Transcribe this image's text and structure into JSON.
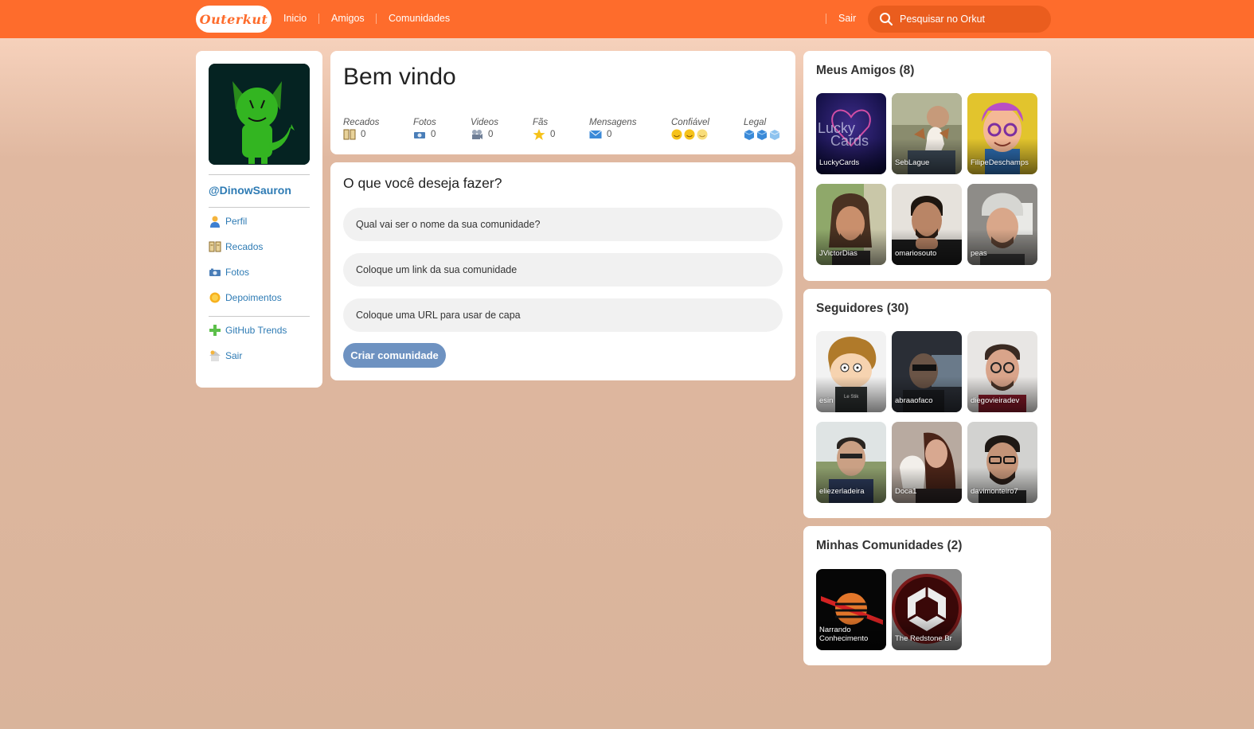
{
  "header": {
    "logo": "Outerkut",
    "nav": [
      "Inicio",
      "Amigos",
      "Comunidades"
    ],
    "logout": "Sair",
    "search_placeholder": "Pesquisar no Orkut"
  },
  "sidebar": {
    "username": "@DinowSauron",
    "menu": [
      "Perfil",
      "Recados",
      "Fotos",
      "Depoimentos"
    ],
    "menu2": [
      "GitHub Trends",
      "Sair"
    ]
  },
  "welcome": {
    "title": "Bem vindo",
    "stats": [
      {
        "label": "Recados",
        "value": "0"
      },
      {
        "label": "Fotos",
        "value": "0"
      },
      {
        "label": "Videos",
        "value": "0"
      },
      {
        "label": "Fãs",
        "value": "0"
      },
      {
        "label": "Mensagens",
        "value": "0"
      },
      {
        "label": "Confiável"
      },
      {
        "label": "Legal"
      }
    ]
  },
  "form": {
    "title": "O que você deseja fazer?",
    "fields": [
      "Qual vai ser o nome da sua comunidade?",
      "Coloque um link da sua comunidade",
      "Coloque uma URL para usar de capa"
    ],
    "submit": "Criar comunidade"
  },
  "friends": {
    "title": "Meus Amigos (8)",
    "items": [
      "LuckyCards",
      "SebLague",
      "FilipeDeschamps",
      "JVictorDias",
      "omariosouto",
      "peas"
    ]
  },
  "followers": {
    "title": "Seguidores (30)",
    "items": [
      "esin",
      "abraaofaco",
      "diegovieiradev",
      "eliezerladeira",
      "Doca1",
      "davimonteiro7"
    ]
  },
  "communities": {
    "title": "Minhas Comunidades (2)",
    "items": [
      "Narrando Conhecimento",
      "The Redstone Br"
    ]
  },
  "colors": {
    "header": "#fe6c2c",
    "link": "#2e7bb4",
    "button": "#6e92c1"
  }
}
